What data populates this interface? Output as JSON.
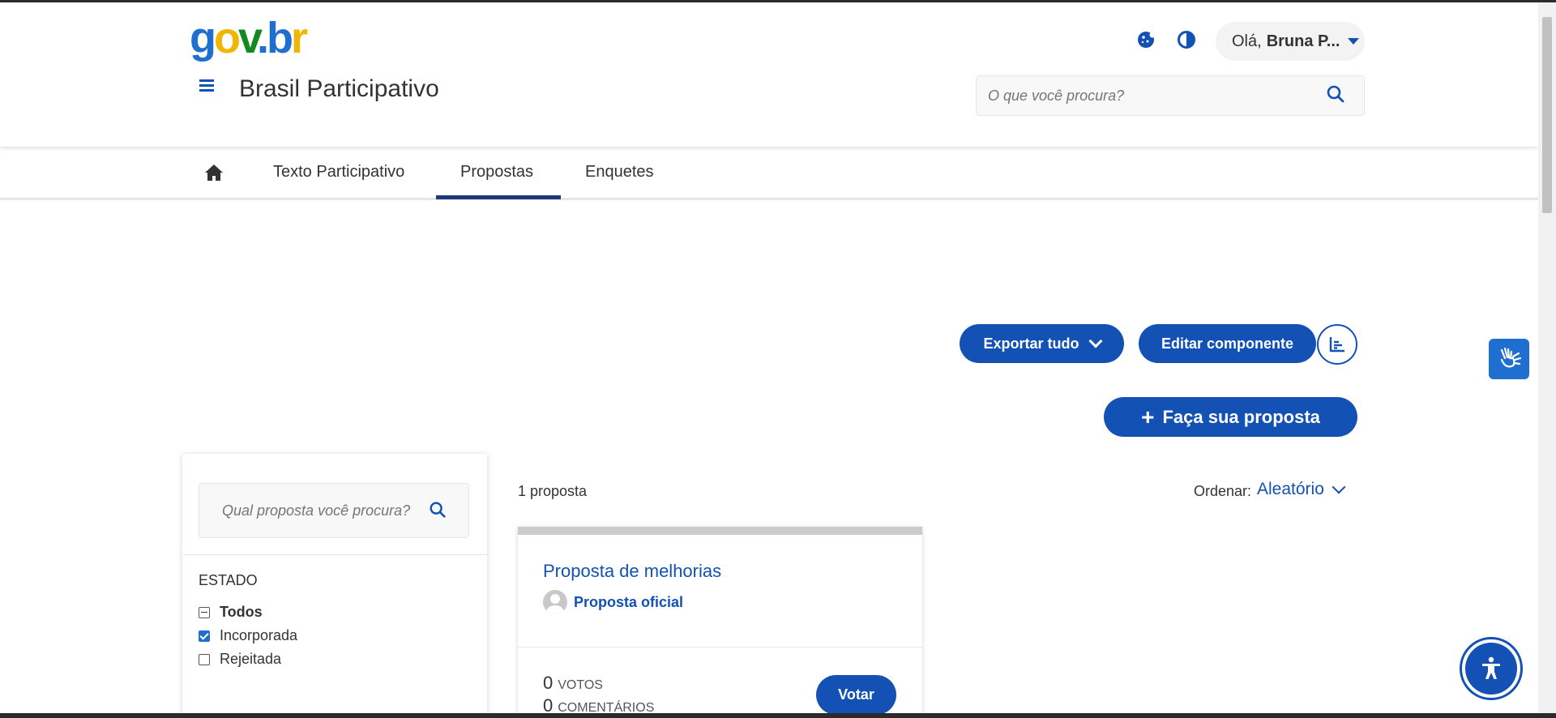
{
  "header": {
    "logo_text": "gov.br",
    "site_title": "Brasil Participativo",
    "user_greeting": "Olá,",
    "user_name": "Bruna P...",
    "search_placeholder": "O que você procura?"
  },
  "tabs": [
    {
      "label": "Texto Participativo"
    },
    {
      "label": "Propostas",
      "active": true
    },
    {
      "label": "Enquetes"
    }
  ],
  "actions": {
    "export_label": "Exportar tudo",
    "edit_label": "Editar componente",
    "new_proposal_label": "Faça sua proposta",
    "new_proposal_icon": "+"
  },
  "filters": {
    "search_placeholder": "Qual proposta você procura?",
    "section_title": "ESTADO",
    "options": [
      {
        "label": "Todos",
        "state": "indeterminate"
      },
      {
        "label": "Incorporada",
        "state": "checked"
      },
      {
        "label": "Rejeitada",
        "state": "unchecked"
      }
    ]
  },
  "results": {
    "count_text": "1 proposta",
    "order_label": "Ordenar:",
    "order_value": "Aleatório"
  },
  "card": {
    "title": "Proposta de melhorias",
    "author": "Proposta oficial",
    "votes_count": "0",
    "votes_label": "VOTOS",
    "comments_count": "0",
    "comments_label": "COMENTÁRIOS",
    "vote_button": "Votar"
  },
  "colors": {
    "primary": "#1351b4",
    "tab_underline": "#1c3a79",
    "libras_widget": "#1f6fd1"
  },
  "icons": {
    "home": "home-icon",
    "search": "search-icon",
    "cookie": "cookie-icon",
    "contrast": "contrast-icon",
    "menu": "hamburger-menu-icon",
    "stats": "bar-chart-icon",
    "libras": "sign-language-hands-icon",
    "accessibility": "accessibility-person-icon"
  }
}
